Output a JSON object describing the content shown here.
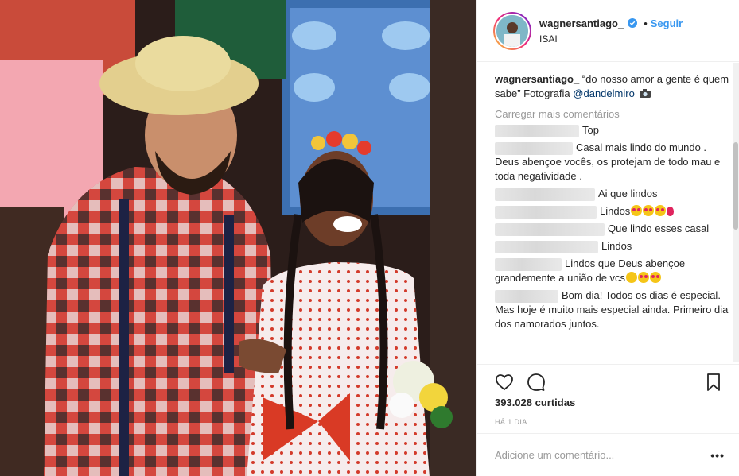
{
  "header": {
    "username": "wagnersantiago_",
    "dot": "•",
    "follow_label": "Seguir",
    "location": "ISAI"
  },
  "caption": {
    "username": "wagnersantiago_",
    "text": "“do nosso amor a gente é quem sabe” Fotografia ",
    "mention": "@dandelmiro"
  },
  "load_more": "Carregar mais comentários",
  "comments": [
    {
      "text": "Top"
    },
    {
      "text": "Casal mais lindo do mundo . Deus abençoe vocês, os protejam de todo mau e toda negatividade ."
    },
    {
      "text": "Ai que lindos"
    },
    {
      "text": "Lindos"
    },
    {
      "text": "Que lindo esses casal"
    },
    {
      "text": "Lindos"
    },
    {
      "text": "Lindos que Deus abençoe grandemente a união de vcs"
    },
    {
      "text": "Bom dia! Todos os dias é especial. Mas hoje é muito mais especial ainda. Primeiro dia dos namorados juntos."
    }
  ],
  "likes": "393.028 curtidas",
  "time": "HÁ 1 DIA",
  "add_comment_placeholder": "Adicione um comentário...",
  "more_label": "•••",
  "icons": [
    "heart-icon",
    "comment-icon",
    "bookmark-icon",
    "verified-icon",
    "camera-emoji-icon",
    "heart-eyes-emoji-icon"
  ],
  "colors": {
    "accent": "#3897f0",
    "mention": "#003569",
    "muted": "#999999"
  }
}
